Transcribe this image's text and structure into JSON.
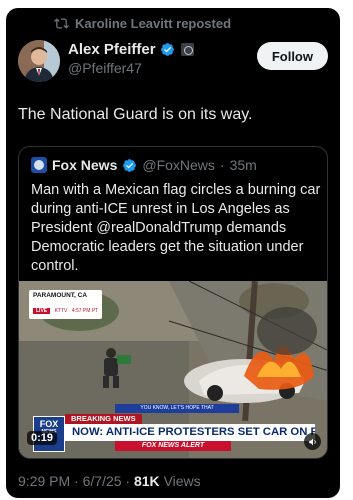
{
  "repost": {
    "text": "Karoline Leavitt reposted",
    "icon": "repost-icon"
  },
  "author": {
    "name": "Alex Pfeiffer",
    "handle": "@Pfeiffer47",
    "avatar": "avatar"
  },
  "follow_label": "Follow",
  "post_text": "The National Guard is on its way.",
  "quote": {
    "name": "Fox News",
    "handle": "@FoxNews",
    "time": "35m",
    "text": "Man with a Mexican flag circles a burning car during anti-ICE unrest in Los Angeles as President @realDonaldTrump demands Democratic leaders get the situation under control.",
    "video": {
      "location": "PARAMOUNT, CA",
      "live": "LIVE",
      "live_meta": "KTTV",
      "live_time": "4:57 PM PT",
      "hope_banner": "YOU KNOW, LET'S HOPE THAT",
      "breaking": "BREAKING NEWS",
      "headline": "NOW: ANTI-ICE PROTESTERS SET CAR ON FIRE IN CA",
      "alert": "FOX NEWS ALERT",
      "logo_line1": "FOX",
      "logo_line2": "NEWS",
      "duration": "0:19"
    }
  },
  "meta": {
    "time": "9:29 PM",
    "date": "6/7/25",
    "views": "81K",
    "views_label": "Views"
  },
  "colors": {
    "background": "#000000",
    "text": "#e7e9ea",
    "muted": "#71767b",
    "verified": "#1d9bf0",
    "fox_red": "#c8102e",
    "fox_blue": "#1b3e8c"
  }
}
